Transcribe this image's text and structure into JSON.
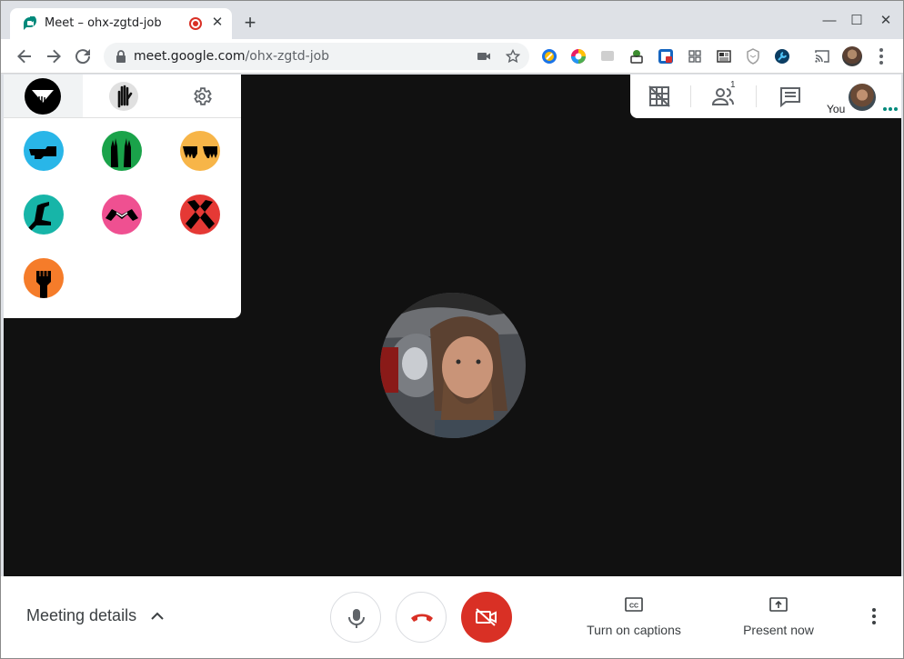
{
  "browser": {
    "tab": {
      "title": "Meet – ohx-zgtd-job",
      "recording_icon": "record-icon",
      "close_label": "✕"
    },
    "new_tab_label": "+",
    "window_controls": {
      "minimize": "—",
      "maximize": "☐",
      "close": "✕"
    },
    "url": {
      "host": "meet.google.com",
      "path": "/ohx-zgtd-job"
    },
    "extensions": [
      "ext-blue-icon",
      "ext-color-wheel-icon",
      "ext-gray-icon",
      "ext-puzzle-icon",
      "ext-red-badge-icon",
      "ext-grid-icon",
      "ext-news-icon",
      "ext-shield-icon",
      "ext-wrench-icon"
    ]
  },
  "reaction_panel": {
    "tabs": [
      "emoji-tab",
      "raise-hand-tab",
      "settings-tab"
    ],
    "reactions": [
      {
        "name": "pointing-hand",
        "color": "#29b6e8"
      },
      {
        "name": "raised-hands",
        "color": "#1aa34a"
      },
      {
        "name": "jazz-hands",
        "color": "#f7b548"
      },
      {
        "name": "c-hand",
        "color": "#17b5a8"
      },
      {
        "name": "heart-hands",
        "color": "#ef5091"
      },
      {
        "name": "crossed-arms",
        "color": "#e53935"
      },
      {
        "name": "raised-fist",
        "color": "#f57c2a"
      }
    ]
  },
  "top_right": {
    "you_label": "You",
    "participant_count": "1"
  },
  "bottom": {
    "meeting_details": "Meeting details",
    "captions_label": "Turn on captions",
    "present_label": "Present now"
  }
}
